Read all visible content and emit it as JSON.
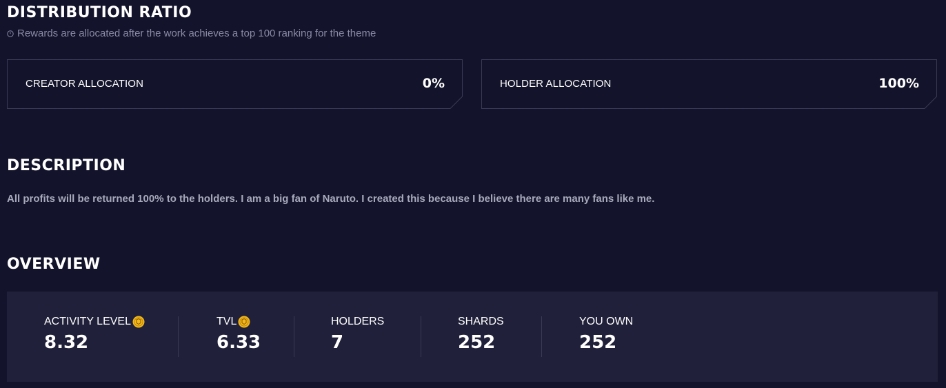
{
  "distribution": {
    "title": "DISTRIBUTION RATIO",
    "note": "Rewards are allocated after the work achieves a top 100 ranking for the theme",
    "note_icon": "clock-icon",
    "creator": {
      "label": "CREATOR ALLOCATION",
      "value": "0%"
    },
    "holder": {
      "label": "HOLDER ALLOCATION",
      "value": "100%"
    }
  },
  "description": {
    "title": "DESCRIPTION",
    "text": "All profits will be returned 100% to the holders. I am a big fan of Naruto. I created this because I believe there are many fans like me."
  },
  "overview": {
    "title": "OVERVIEW",
    "coin_icon": "gold-coin-icon",
    "coin_color": "#f2b81c",
    "stats": [
      {
        "label": "ACTIVITY LEVEL",
        "value": "8.32",
        "coin": true
      },
      {
        "label": "TVL",
        "value": "6.33",
        "coin": true
      },
      {
        "label": "HOLDERS",
        "value": "7",
        "coin": false
      },
      {
        "label": "SHARDS",
        "value": "252",
        "coin": false
      },
      {
        "label": "YOU OWN",
        "value": "252",
        "coin": false
      }
    ]
  },
  "colors": {
    "background": "#13132b",
    "panel": "#20203a",
    "border": "#3a3a55",
    "muted_text": "#8a8aa6"
  }
}
